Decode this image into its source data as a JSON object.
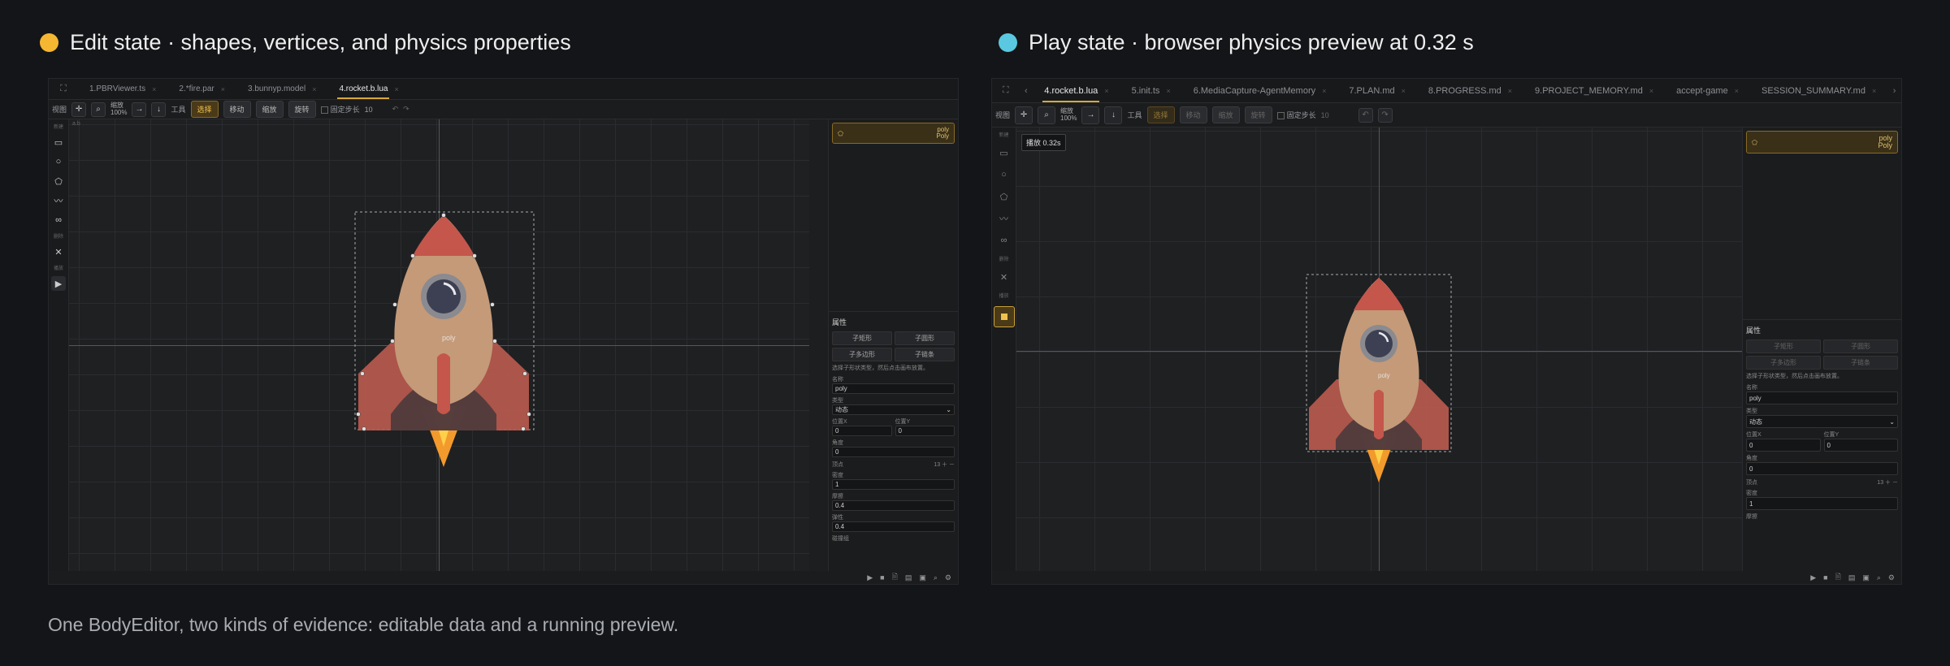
{
  "left": {
    "heading": "Edit state · shapes, vertices, and physics properties",
    "dot_color": "#f5b731",
    "tabs": [
      {
        "label": "1.PBRViewer.ts"
      },
      {
        "label": "2.*fire.par"
      },
      {
        "label": "3.bunnyp.model"
      },
      {
        "label": "4.rocket.b.lua",
        "active": true
      }
    ],
    "toolbar": {
      "view_label": "视图",
      "zoom_label": "缩放",
      "zoom_value": "100%",
      "tools_label": "工具",
      "select": "选择",
      "move": "移动",
      "scale": "缩放",
      "rotate": "旋转",
      "fixed_step": "固定步长",
      "step_value": "10"
    },
    "sidebar": {
      "new_label": "新建",
      "delete_label": "删除",
      "play_label": "播放"
    },
    "ruler_label": "a.b",
    "shape": {
      "name": "poly",
      "type": "Poly"
    },
    "props": {
      "title": "属性",
      "btn_rect": "子矩形",
      "btn_circle": "子圆形",
      "btn_poly": "子多边形",
      "btn_chain": "子链条",
      "hint": "选择子形状类型，然后点击画布放置。",
      "name_label": "名称",
      "name_value": "poly",
      "type_label": "类型",
      "type_value": "动态",
      "posx_label": "位置X",
      "posx_value": "0",
      "posy_label": "位置Y",
      "posy_value": "0",
      "angle_label": "角度",
      "angle_value": "0",
      "vertices_label": "顶点",
      "vertices_count": "13",
      "density_label": "密度",
      "density_value": "1",
      "friction_label": "摩擦",
      "friction_value": "0.4",
      "restitution_label": "弹性",
      "restitution_value": "0.4",
      "extra_label": "碰撞组"
    },
    "canvas_label": "poly"
  },
  "right": {
    "heading": "Play state · browser physics preview at 0.32 s",
    "dot_color": "#5ac8e0",
    "tabs": [
      {
        "label": "4.rocket.b.lua",
        "active": true
      },
      {
        "label": "5.init.ts"
      },
      {
        "label": "6.MediaCapture-AgentMemory"
      },
      {
        "label": "7.PLAN.md"
      },
      {
        "label": "8.PROGRESS.md"
      },
      {
        "label": "9.PROJECT_MEMORY.md"
      },
      {
        "label": "accept-game"
      },
      {
        "label": "SESSION_SUMMARY.md"
      }
    ],
    "toolbar": {
      "view_label": "视图",
      "zoom_label": "缩放",
      "zoom_value": "100%",
      "tools_label": "工具",
      "select": "选择",
      "move": "移动",
      "scale": "缩放",
      "rotate": "旋转",
      "fixed_step": "固定步长",
      "step_value": "10"
    },
    "sidebar": {
      "new_label": "新建",
      "delete_label": "删除",
      "play_label": "播放"
    },
    "tooltip": "播放 0.32s",
    "shape": {
      "name": "poly",
      "type": "Poly"
    },
    "props": {
      "title": "属性",
      "btn_rect": "子矩形",
      "btn_circle": "子圆形",
      "btn_poly": "子多边形",
      "btn_chain": "子链条",
      "hint": "选择子形状类型，然后点击画布放置。",
      "name_label": "名称",
      "name_value": "poly",
      "type_label": "类型",
      "type_value": "动态",
      "posx_label": "位置X",
      "posx_value": "0",
      "posy_label": "位置Y",
      "posy_value": "0",
      "angle_label": "角度",
      "angle_value": "0",
      "vertices_label": "顶点",
      "vertices_count": "13",
      "density_label": "密度",
      "density_value": "1",
      "friction_label": "摩擦"
    },
    "canvas_label": "poly"
  },
  "caption": "One BodyEditor, two kinds of evidence: editable data and a running preview."
}
